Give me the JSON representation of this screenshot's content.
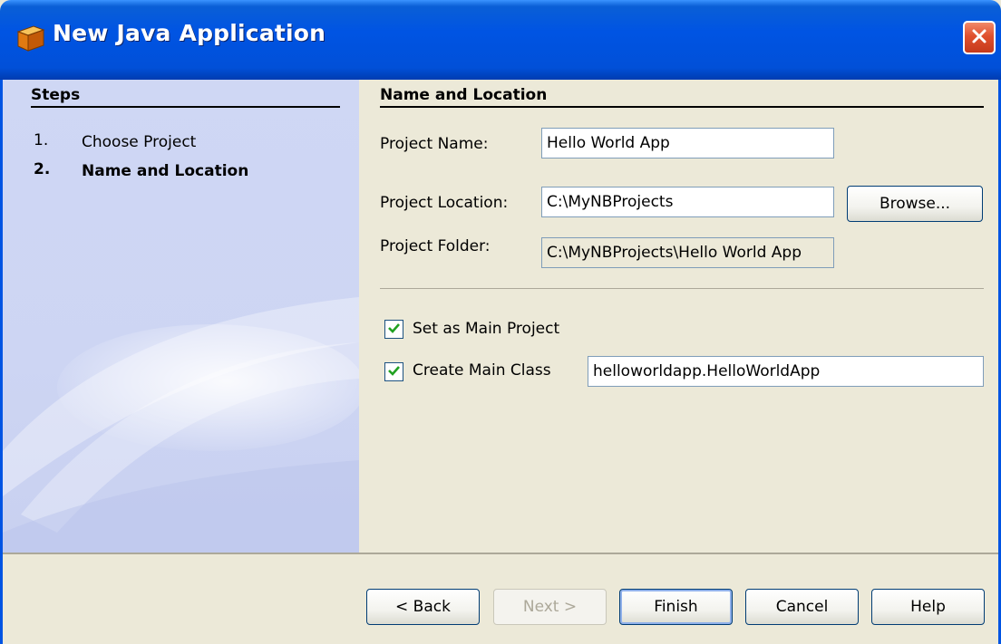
{
  "window": {
    "title": "New Java Application",
    "icons": {
      "app": "netbeans-project-icon",
      "close": "close-icon"
    }
  },
  "steps": {
    "title": "Steps",
    "items": [
      {
        "number": "1.",
        "label": "Choose Project",
        "current": false
      },
      {
        "number": "2.",
        "label": "Name and Location",
        "current": true
      }
    ]
  },
  "form": {
    "section_title": "Name and Location",
    "project_name": {
      "label": "Project Name:",
      "value": "Hello World App"
    },
    "project_location": {
      "label": "Project Location:",
      "value": "C:\\MyNBProjects",
      "browse_label": "Browse..."
    },
    "project_folder": {
      "label": "Project Folder:",
      "value": "C:\\MyNBProjects\\Hello World App"
    },
    "set_main_project": {
      "label": "Set as Main Project",
      "checked": true
    },
    "create_main_class": {
      "label": "Create Main Class",
      "checked": true,
      "value": "helloworldapp.HelloWorldApp"
    }
  },
  "buttons": {
    "back": "< Back",
    "next": "Next >",
    "finish": "Finish",
    "cancel": "Cancel",
    "help": "Help"
  },
  "colors": {
    "titlebar": "#0054e3",
    "steps_panel": "#cdd5f3",
    "dialog_bg": "#ece9d8",
    "checkmark": "#21a121",
    "close_button": "#e0502e"
  }
}
